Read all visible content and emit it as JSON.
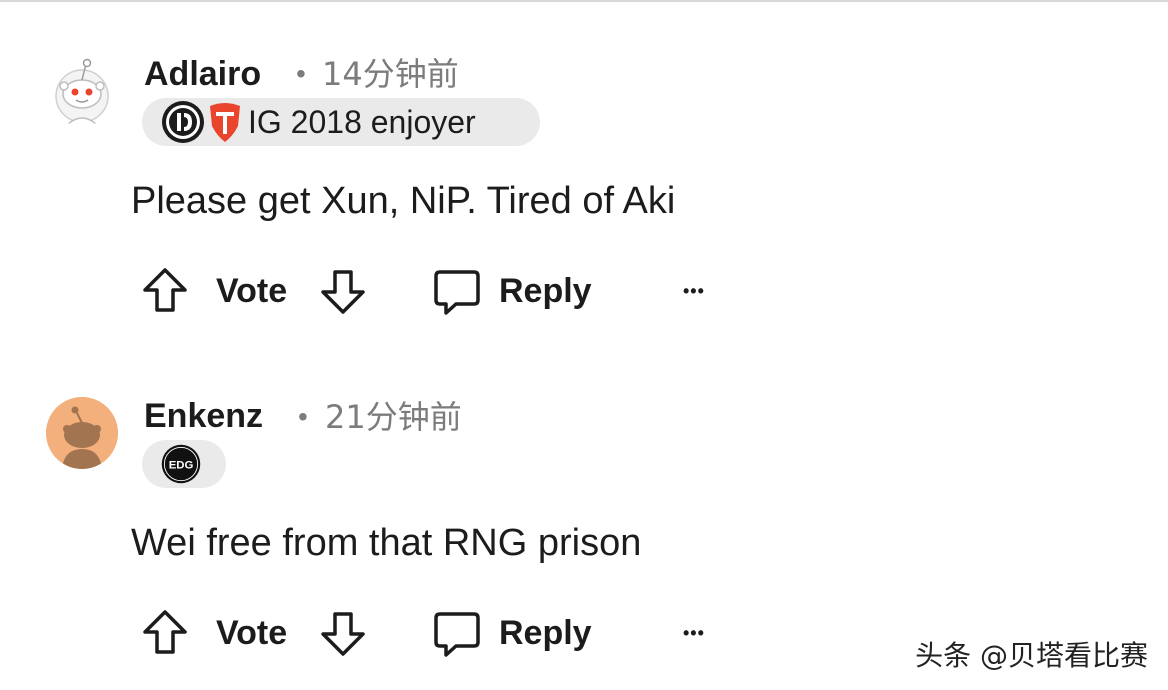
{
  "comments": [
    {
      "username": "Adlairo",
      "separator": "•",
      "time": "14分钟前",
      "flair": {
        "text": "IG 2018 enjoyer",
        "icons": [
          "invictus-gaming-logo",
          "top-esports-logo"
        ]
      },
      "body": "Please get Xun, NiP. Tired of Aki",
      "actions": {
        "vote_label": "Vote",
        "reply_label": "Reply",
        "more_label": "•••"
      }
    },
    {
      "username": "Enkenz",
      "separator": "•",
      "time": "21分钟前",
      "flair": {
        "text": "",
        "icons": [
          "edg-logo"
        ],
        "edg_text": "EDG"
      },
      "body": "Wei free from that RNG prison",
      "actions": {
        "vote_label": "Vote",
        "reply_label": "Reply",
        "more_label": "•••"
      }
    }
  ],
  "watermark": "头条 @贝塔看比赛",
  "colors": {
    "text": "#1c1c1c",
    "meta": "#7c7c7c",
    "flair_bg": "#eaeaea",
    "avatar2_bg": "#f3b07c",
    "tes_red": "#e8452c"
  }
}
